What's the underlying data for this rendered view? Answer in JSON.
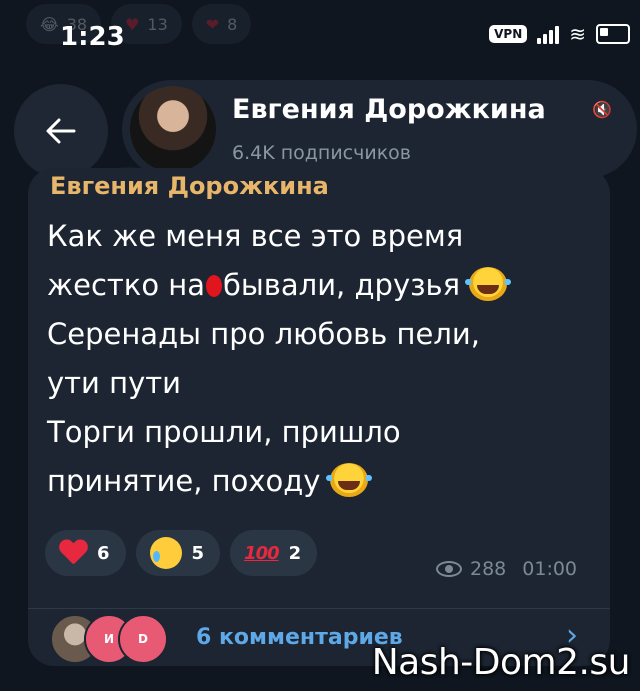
{
  "top_reactions": [
    {
      "emoji": "laugh-icon",
      "count": "38"
    },
    {
      "emoji": "heart-icon",
      "count": "13"
    },
    {
      "emoji": "heart-fire-icon",
      "count": "8"
    }
  ],
  "status_bar": {
    "time": "1:23",
    "vpn": "VPN"
  },
  "header": {
    "channel_name": "Евгения Дорожкина",
    "subscribers": "6.4K подписчиков"
  },
  "message": {
    "sender": "Евгения Дорожкина",
    "line1": "Как же меня все это время",
    "line2_a": "жестко на",
    "line2_b": "бывали, друзья ",
    "line3": "Серенады про любовь пели,",
    "line4": "ути пути",
    "line5": "Торги прошли, пришло",
    "line6": "принятие, походу ",
    "views": "288",
    "time": "01:00"
  },
  "reactions": [
    {
      "emoji": "heart-icon",
      "count": "6"
    },
    {
      "emoji": "crying-face-icon",
      "count": "5"
    },
    {
      "emoji": "hundred-icon",
      "symbol": "100",
      "count": "2"
    }
  ],
  "comments": {
    "label": "6 комментариев",
    "avatar2_initials": "И",
    "avatar3_initials": "D"
  },
  "watermark": "Nash-Dom2.su",
  "colors": {
    "background": "#0f1620",
    "bubble": "#1c2531",
    "sender": "#e7b66a",
    "link": "#5fa8e8"
  }
}
